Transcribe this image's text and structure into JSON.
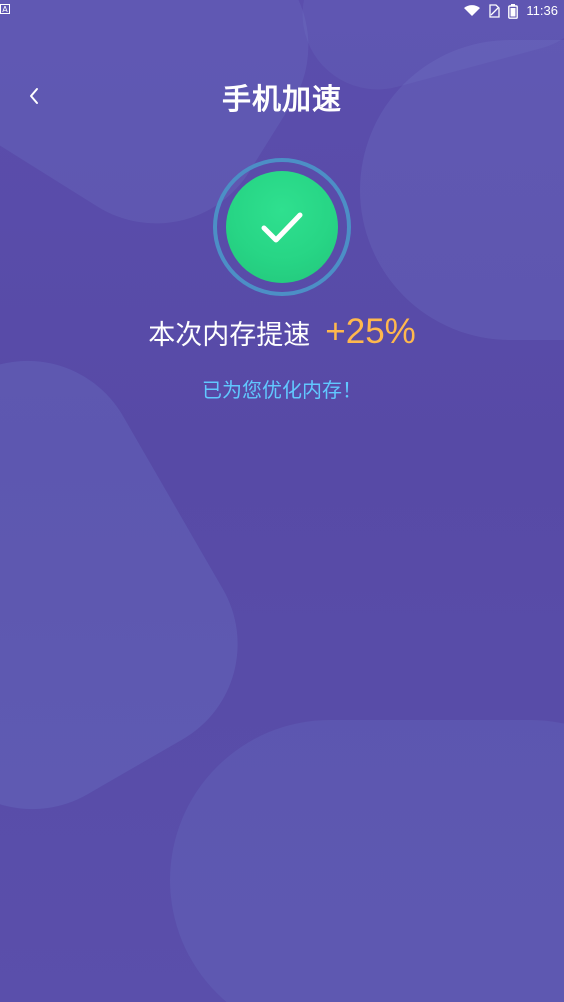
{
  "status_bar": {
    "left_icon": "A",
    "time": "11:36",
    "icons": [
      "wifi-icon",
      "sim-icon",
      "battery-icon"
    ]
  },
  "header": {
    "title": "手机加速"
  },
  "result": {
    "icon": "check-icon",
    "speed_label": "本次内存提速",
    "speed_value": "+25%",
    "message": "已为您优化内存！"
  },
  "colors": {
    "background": "#5A4CA8",
    "success_green": "#27D585",
    "ring_blue": "#4C8FC6",
    "speed_orange": "#FFB84D",
    "message_blue": "#61C8FF"
  }
}
